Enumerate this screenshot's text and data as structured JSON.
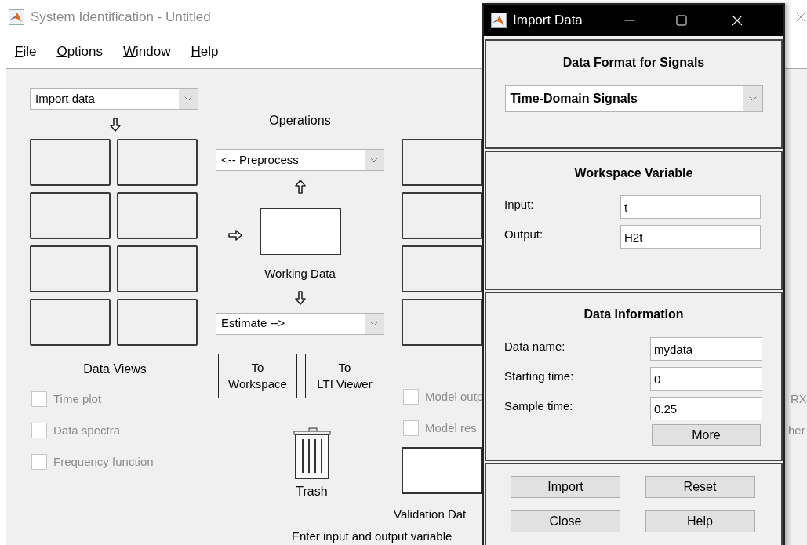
{
  "window": {
    "title": "System Identification - Untitled"
  },
  "menu": [
    {
      "label": "File"
    },
    {
      "label": "Options"
    },
    {
      "label": "Window"
    },
    {
      "label": "Help"
    }
  ],
  "data_panel": {
    "import_select": "Import data",
    "title": "Data Views",
    "options": [
      {
        "label": "Time plot",
        "checked": false,
        "disabled": true
      },
      {
        "label": "Data spectra",
        "checked": false,
        "disabled": true
      },
      {
        "label": "Frequency function",
        "checked": false,
        "disabled": true
      }
    ]
  },
  "operations": {
    "title": "Operations",
    "preprocess_select": "<-- Preprocess",
    "working_data_label": "Working Data",
    "estimate_select": "Estimate -->",
    "buttons": [
      "To\nWorkspace",
      "To\nLTI Viewer"
    ],
    "trash_label": "Trash",
    "hint": "Enter input and output variable"
  },
  "model_panel": {
    "options": [
      {
        "label": "Model outp",
        "checked": false,
        "disabled": true
      },
      {
        "label": "Model res",
        "checked": false,
        "disabled": true
      }
    ],
    "validation_label": "Validation Dat"
  },
  "partial_labels": [
    "RX",
    "her"
  ],
  "dialog": {
    "title": "Import Data",
    "format": {
      "title": "Data Format for Signals",
      "select": "Time-Domain Signals"
    },
    "workspace": {
      "title": "Workspace Variable",
      "fields": [
        {
          "label": "Input:",
          "value": "t"
        },
        {
          "label": "Output:",
          "value": "H2t"
        }
      ]
    },
    "info": {
      "title": "Data Information",
      "fields": [
        {
          "label": "Data name:",
          "value": "mydata"
        },
        {
          "label": "Starting time:",
          "value": "0"
        },
        {
          "label": "Sample time:",
          "value": "0.25"
        }
      ],
      "more_button": "More"
    },
    "buttons": [
      "Import",
      "Reset",
      "Close",
      "Help"
    ]
  }
}
